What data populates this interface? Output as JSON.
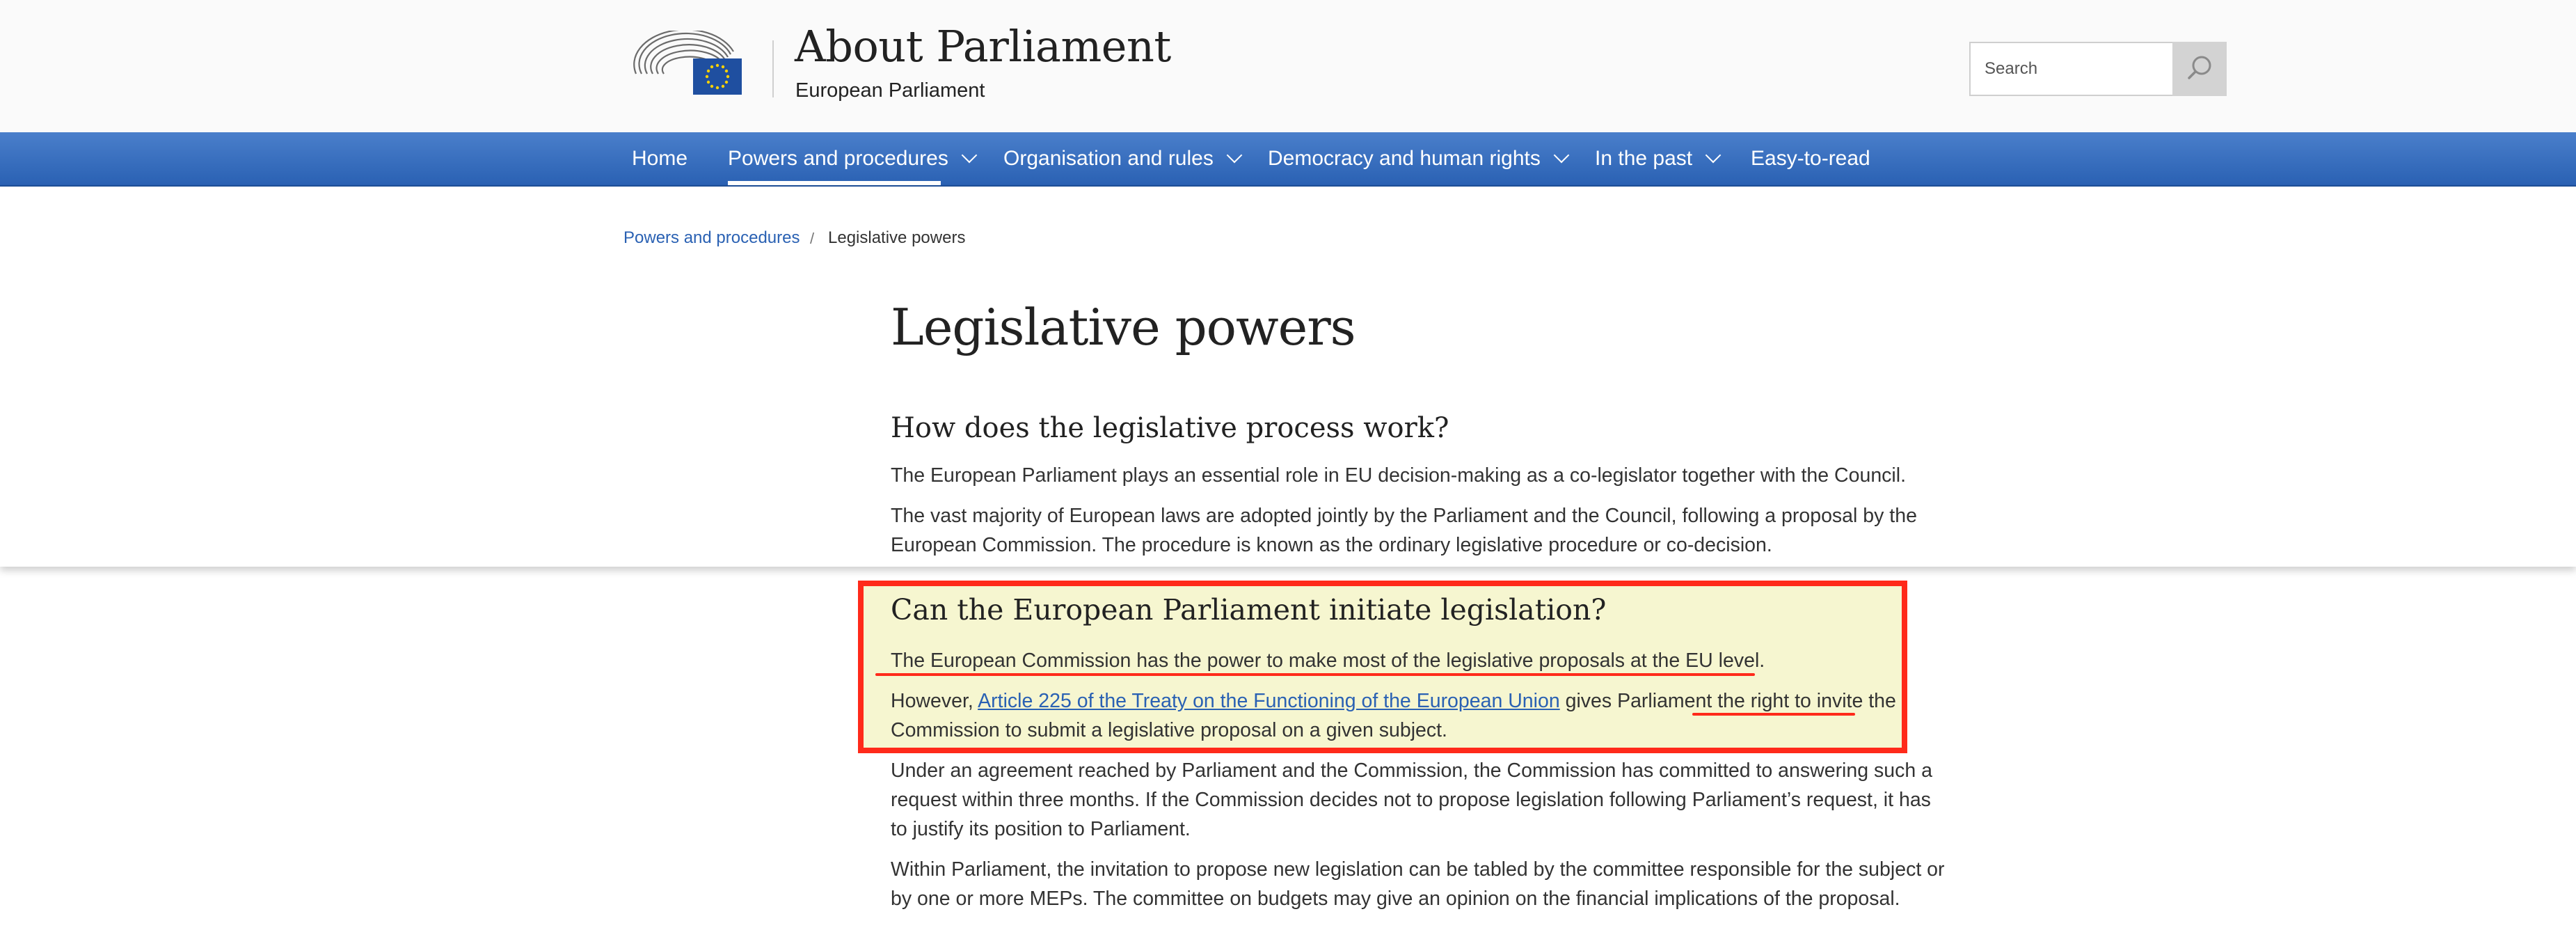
{
  "header": {
    "site_title": "About Parliament",
    "site_subtitle": "European Parliament",
    "search_placeholder": "Search"
  },
  "nav": {
    "items": [
      {
        "label": "Home"
      },
      {
        "label": "Powers and procedures",
        "active": true
      },
      {
        "label": "Organisation and rules"
      },
      {
        "label": "Democracy and human rights"
      },
      {
        "label": "In the past"
      },
      {
        "label": "Easy-to-read"
      }
    ]
  },
  "breadcrumb": {
    "link": "Powers and procedures",
    "separator": "/",
    "current": "Legislative powers"
  },
  "page": {
    "title": "Legislative powers",
    "section1": {
      "heading": "How does the legislative process work?",
      "p1": "The European Parliament plays an essential role in EU decision-making as a co-legislator together with the Council.",
      "p2": "The vast majority of European laws are adopted jointly by the Parliament and the Council, following a proposal by the European Commission. The procedure is known as the ordinary legislative procedure or co-decision."
    },
    "section2": {
      "heading": "Can the European Parliament initiate legislation?",
      "p1": "The European Commission has the power to make most of the legislative proposals at the EU level.",
      "p2_before": "However, ",
      "p2_link": "Article 225 of the Treaty on the Functioning of the European Union",
      "p2_after": " gives Parliament the right to invite the Commission to submit a legislative proposal on a given subject.",
      "p3": "Under an agreement reached by Parliament and the Commission, the Commission has committed to answering such a request within three months. If the Commission decides not to propose legislation following Parliament’s request, it has to justify its position to Parliament.",
      "p4": "Within Parliament, the invitation to propose new legislation can be tabled by the committee responsible for the subject or by one or more MEPs. The committee on budgets may give an opinion on the financial implications of the proposal."
    }
  },
  "colors": {
    "nav_blue": "#2a61b3",
    "annotation_red": "#ff2a1a",
    "highlight_fill": "#f6f6d0"
  }
}
